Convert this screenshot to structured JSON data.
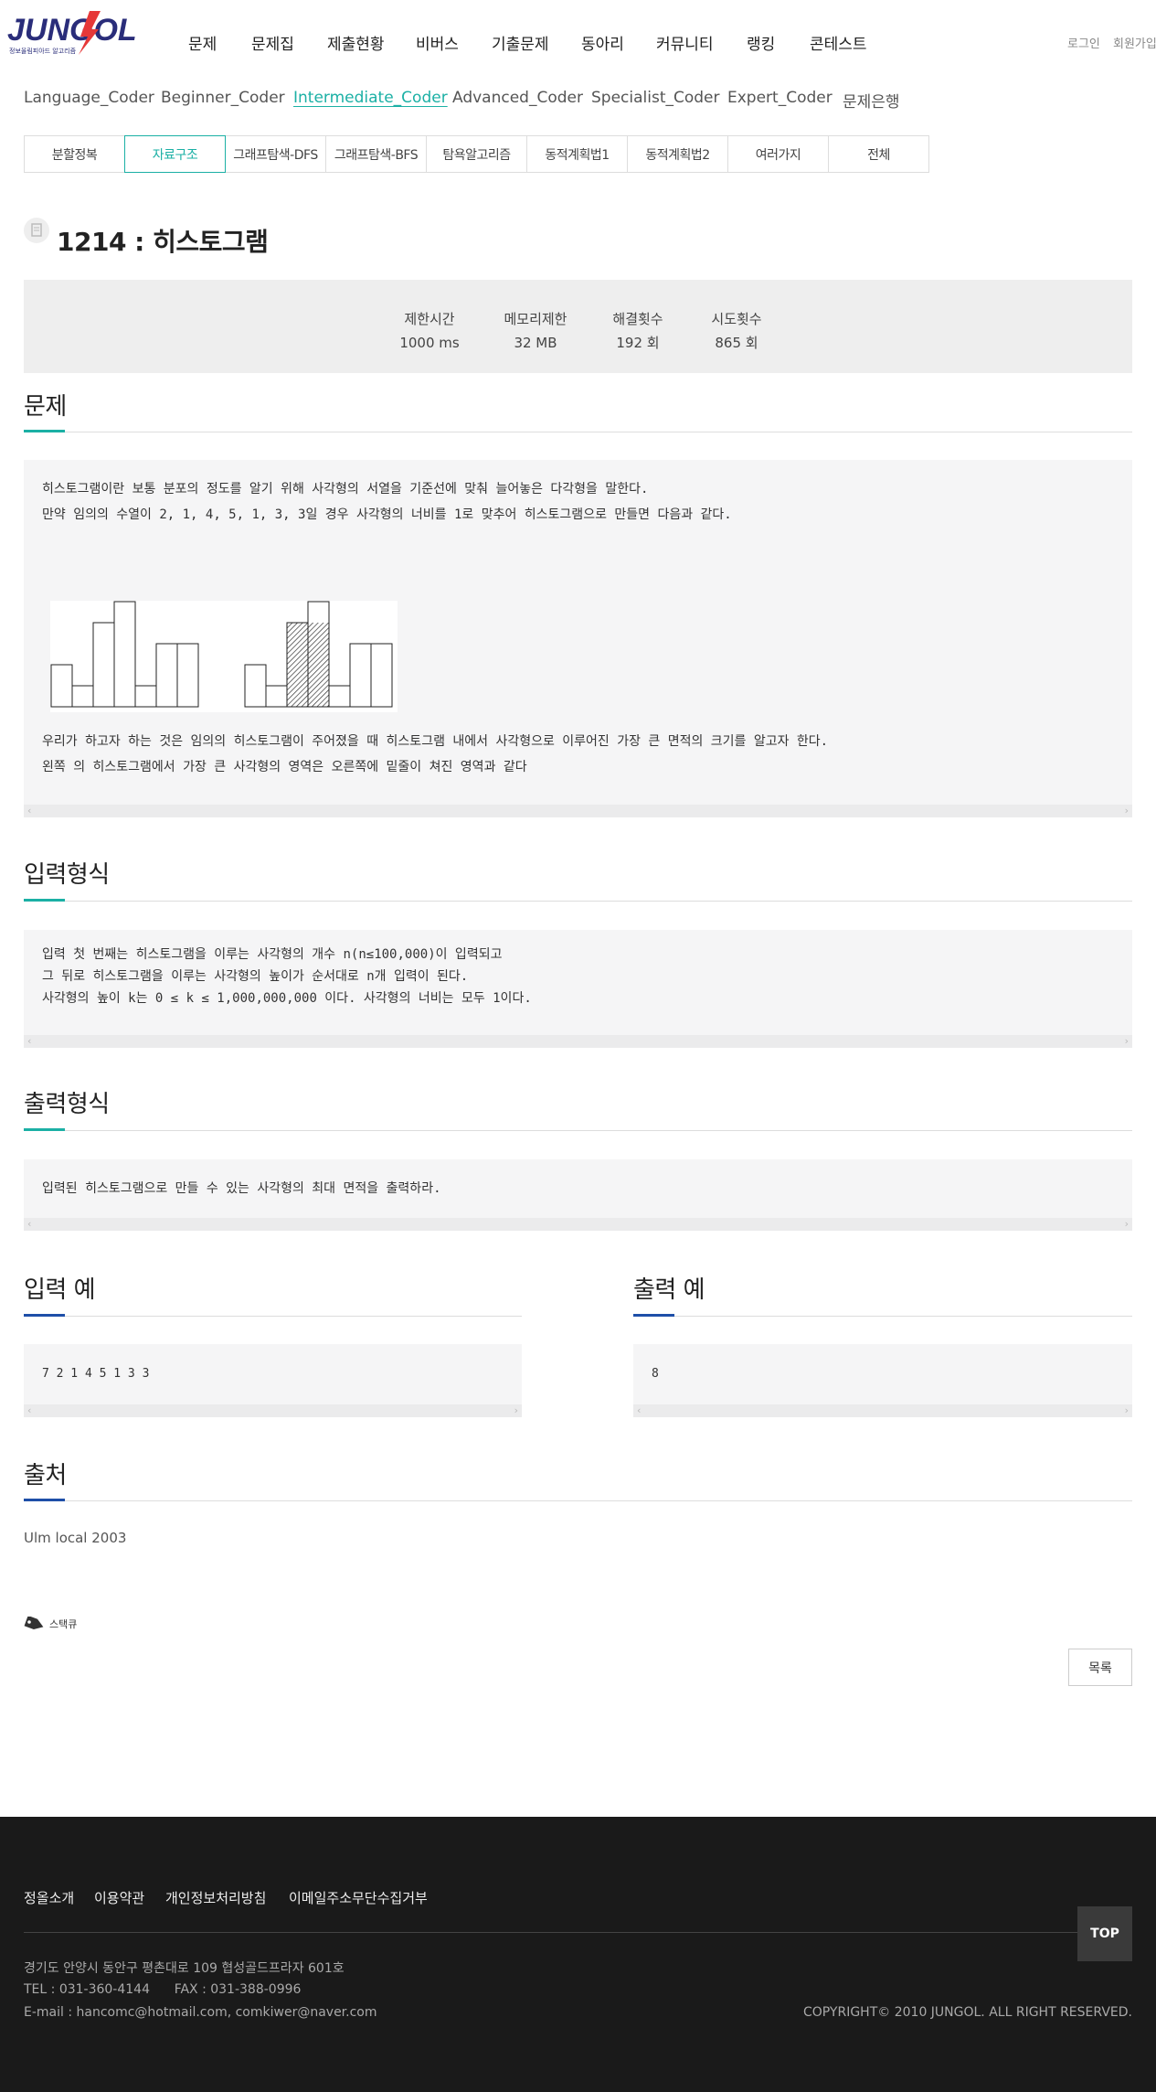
{
  "header": {
    "logo_text": "JUNGOL",
    "logo_sub": "정보올림피아드 알고리즘",
    "nav": [
      "문제",
      "문제집",
      "제출현황",
      "비버스",
      "기출문제",
      "동아리",
      "커뮤니티",
      "랭킹",
      "콘테스트"
    ],
    "login": "로그인",
    "signup": "회원가입"
  },
  "subnav": [
    "Language_Coder",
    "Beginner_Coder",
    "Intermediate_Coder",
    "Advanced_Coder",
    "Specialist_Coder",
    "Expert_Coder",
    "문제은행"
  ],
  "categories": [
    "분할정복",
    "자료구조",
    "그래프탐색-DFS",
    "그래프탐색-BFS",
    "탐욕알고리즘",
    "동적계획법1",
    "동적계획법2",
    "여러가지",
    "전체"
  ],
  "problem": {
    "title": "1214 : 히스토그램",
    "stats": [
      {
        "label": "제한시간",
        "value": "1000 ms"
      },
      {
        "label": "메모리제한",
        "value": "32 MB"
      },
      {
        "label": "해결횟수",
        "value": "192 회"
      },
      {
        "label": "시도횟수",
        "value": "865 회"
      }
    ]
  },
  "sections": {
    "problem_title": "문제",
    "problem_line1": "히스토그램이란 보통 분포의 정도를 알기 위해 사각형의 서열을 기준선에 맞춰 늘어놓은 다각형을 말한다.",
    "problem_line2": "만약 임의의 수열이 2, 1, 4, 5, 1, 3, 3일 경우 사각형의 너비를 1로 맞추어 히스토그램으로 만들면 다음과 같다.",
    "problem_line3": "우리가 하고자 하는 것은 임의의 히스토그램이 주어졌을 때 히스토그램 내에서 사각형으로 이루어진 가장 큰 면적의 크기를 알고자 한다.",
    "problem_line4": "왼쪽 의 히스토그램에서 가장 큰 사각형의 영역은 오른쪽에 밑줄이 쳐진 영역과 같다",
    "input_title": "입력형식",
    "input_line1": "입력 첫 번째는 히스토그램을 이루는 사각형의 개수 n(n≤100,000)이 입력되고",
    "input_line2": "그 뒤로 히스토그램을 이루는 사각형의 높이가 순서대로 n개 입력이 된다.",
    "input_line3": "사각형의 높이 k는 0 ≤ k ≤ 1,000,000,000 이다. 사각형의 너비는 모두 1이다.",
    "output_title": "출력형식",
    "output_line1": "입력된 히스토그램으로 만들 수 있는 사각형의 최대 면적을 출력하라.",
    "sample_in_title": "입력 예",
    "sample_in": "7 2 1 4 5 1 3 3",
    "sample_out_title": "출력 예",
    "sample_out": "8",
    "source_title": "출처",
    "source": "Ulm local 2003"
  },
  "histogram_heights": [
    2,
    1,
    4,
    5,
    1,
    3,
    3
  ],
  "scrap": "스택큐",
  "list_button": "목록",
  "footer": {
    "links": [
      "정올소개",
      "이용약관",
      "개인정보처리방침",
      "이메일주소무단수집거부"
    ],
    "address": "경기도 안양시 동안구 평촌대로 109 협성골드프라자 601호",
    "tel": "TEL : 031-360-4144      FAX : 031-388-0996",
    "email": "E-mail : hancomc@hotmail.com, comkiwer@naver.com",
    "copyright": "COPYRIGHT© 2010 JUNGOL. ALL RIGHT RESERVED.",
    "top": "TOP"
  },
  "colors": {
    "accent": "#1bb0a5",
    "section_accent_teal": "#1bb0a5",
    "section_accent_blue": "#1e4fa8",
    "footer_bg": "#1a1a1a"
  }
}
